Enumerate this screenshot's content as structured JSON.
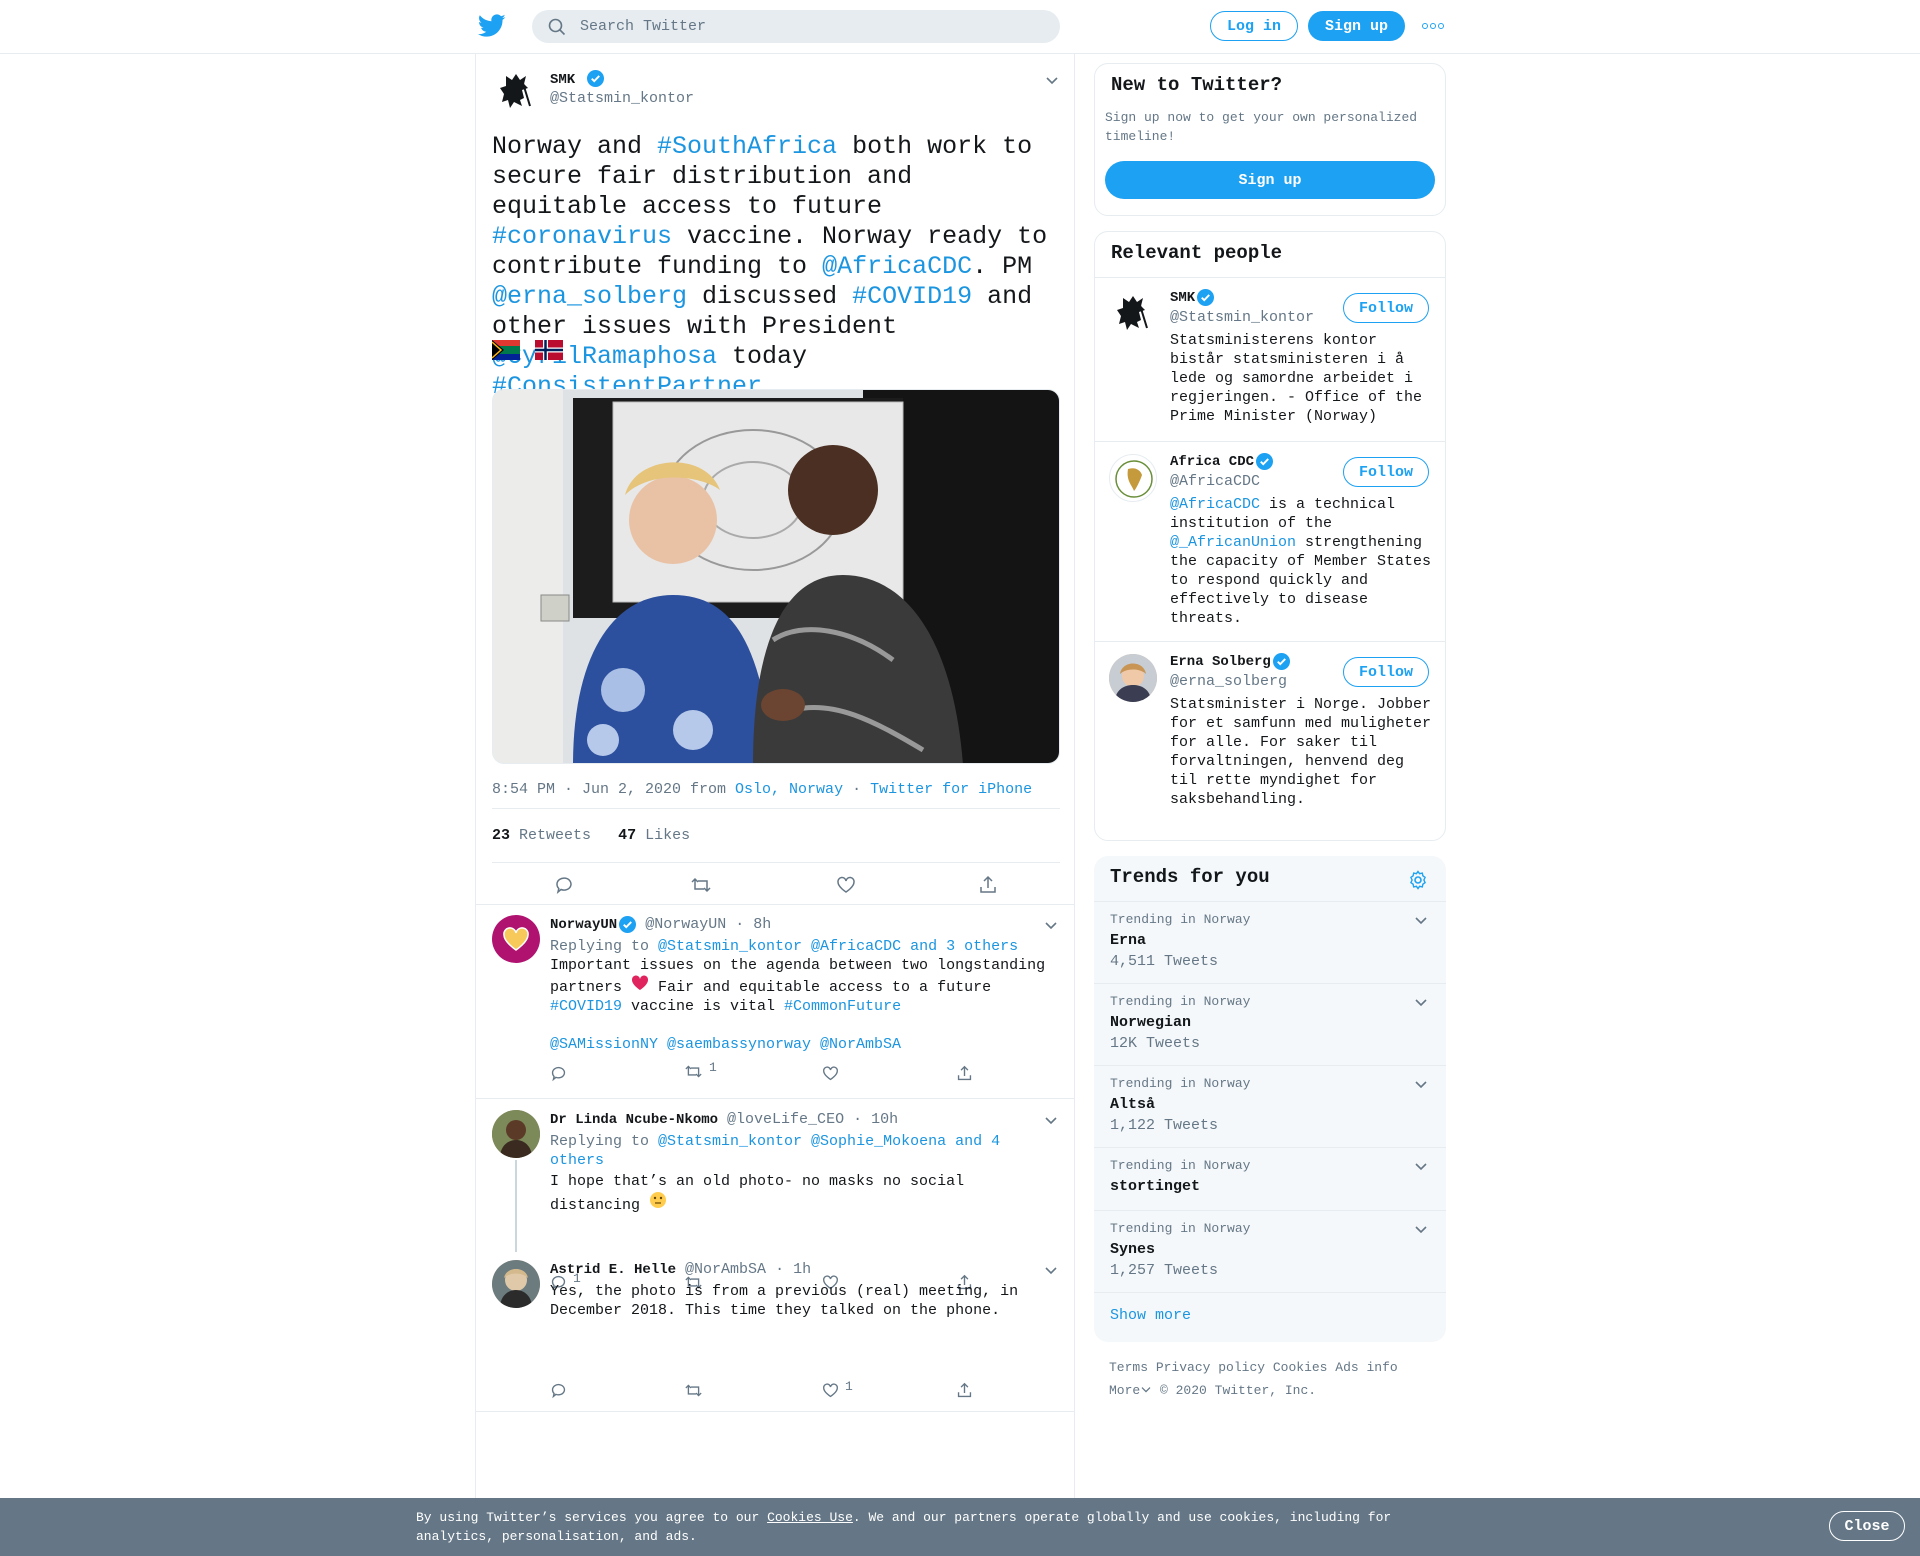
{
  "header": {
    "search_placeholder": "Search Twitter",
    "login": "Log in",
    "signup": "Sign up"
  },
  "tweet": {
    "name": "SMK",
    "handle": "@Statsmin_kontor",
    "text_parts": [
      {
        "t": "Norway and ",
        "link": false
      },
      {
        "t": "#SouthAfrica",
        "link": true
      },
      {
        "t": " both work to secure fair distribution and equitable access to future ",
        "link": false
      },
      {
        "t": "#coronavirus",
        "link": true
      },
      {
        "t": " vaccine. Norway ready to contribute funding to ",
        "link": false
      },
      {
        "t": "@AfricaCDC",
        "link": true
      },
      {
        "t": ". PM ",
        "link": false
      },
      {
        "t": "@erna_solberg",
        "link": true
      },
      {
        "t": " discussed ",
        "link": false
      },
      {
        "t": "#COVID19",
        "link": true
      },
      {
        "t": " and other issues with President ",
        "link": false
      },
      {
        "t": "@CyrilRamaphosa",
        "link": true
      },
      {
        "t": " today ",
        "link": false
      },
      {
        "t": "#ConsistentPartner",
        "link": true
      }
    ],
    "time": "8:54 PM · Jun 2, 2020 from ",
    "location": "Oslo, Norway",
    "sep": " · ",
    "source": "Twitter for iPhone",
    "retweets_count": "23",
    "retweets_label": "Retweets",
    "likes_count": "47",
    "likes_label": "Likes"
  },
  "replies": [
    {
      "name": "NorwayUN",
      "handle": "@NorwayUN",
      "time": "· 8h",
      "replying_label": "Replying to ",
      "replying_to": "@Statsmin_kontor @AfricaCDC and 3 others",
      "text1": "Important issues on the agenda between two longstanding partners ",
      "text2": " Fair and equitable access to a future ",
      "tag1": "#COVID19",
      "text3": " vaccine is vital ",
      "tag2": "#CommonFuture",
      "mentions": "@SAMissionNY @saembassynorway @NorAmbSA",
      "retweets": "1"
    },
    {
      "name": "Dr Linda Ncube-Nkomo",
      "handle": "@loveLife_CEO",
      "time": "· 10h",
      "replying_label": "Replying to ",
      "replying_to": "@Statsmin_kontor @Sophie_Mokoena and 4 others",
      "text": "I hope that’s an old photo- no masks no social distancing ",
      "replies": "1"
    },
    {
      "name": "Astrid E. Helle",
      "handle": "@NorAmbSA",
      "time": "· 1h",
      "text": "Yes, the photo is from a previous (real) meeting, in December 2018. This time they talked on the phone.",
      "likes": "1"
    }
  ],
  "new_to_twitter": {
    "title": "New to Twitter?",
    "subtitle": "Sign up now to get your own personalized timeline!",
    "button": "Sign up"
  },
  "relevant_people": {
    "title": "Relevant people",
    "follow_label": "Follow",
    "people": [
      {
        "name": "SMK",
        "handle": "@Statsmin_kontor",
        "bio": "Statsministerens kontor bistår statsministeren i å lede og samordne arbeidet i regjeringen. - Office of the Prime Minister (Norway)"
      },
      {
        "name": "Africa CDC",
        "handle": "@AfricaCDC",
        "bio_link1": "@AfricaCDC",
        "bio_text1": " is a technical institution of the ",
        "bio_link2": "@_AfricanUnion",
        "bio_text2": " strengthening the capacity of Member States to respond quickly and effectively to disease threats."
      },
      {
        "name": "Erna Solberg",
        "handle": "@erna_solberg",
        "bio": "Statsminister i Norge. Jobber for et samfunn med muligheter for alle. For saker til forvaltningen, henvend deg til rette myndighet for saksbehandling."
      }
    ]
  },
  "trends": {
    "title": "Trends for you",
    "items": [
      {
        "context": "Trending in Norway",
        "name": "Erna",
        "count": "4,511 Tweets"
      },
      {
        "context": "Trending in Norway",
        "name": "Norwegian",
        "count": "12K Tweets"
      },
      {
        "context": "Trending in Norway",
        "name": "Altså",
        "count": "1,122 Tweets"
      },
      {
        "context": "Trending in Norway",
        "name": "stortinget",
        "count": ""
      },
      {
        "context": "Trending in Norway",
        "name": "Synes",
        "count": "1,257 Tweets"
      }
    ],
    "show_more": "Show more"
  },
  "footer": {
    "terms": "Terms",
    "privacy": "Privacy policy",
    "cookies": "Cookies",
    "ads": "Ads info",
    "more": "More",
    "copyright": "© 2020 Twitter, Inc."
  },
  "cookie_banner": {
    "text1": "By using Twitter’s services you agree to our ",
    "link": "Cookies Use",
    "text2": ". We and our partners operate globally and use cookies, including for analytics, personalisation, and ads.",
    "close": "Close"
  },
  "colors": {
    "accent": "#1da1f2",
    "link": "#1b95e0",
    "banner": "#657786"
  }
}
